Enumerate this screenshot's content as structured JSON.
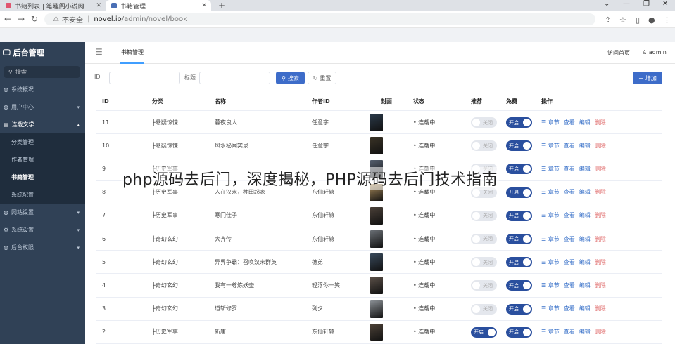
{
  "browser": {
    "tabs": [
      {
        "title": "书籍列表 | 笔趣阁小说网"
      },
      {
        "title": "书籍管理"
      }
    ],
    "url_warning": "不安全",
    "url_host": "novel.io",
    "url_path": "/admin/novel/book"
  },
  "sidebar": {
    "brand": "后台管理",
    "search_label": "搜索",
    "menu": [
      {
        "label": "系统概况"
      },
      {
        "label": "用户中心"
      },
      {
        "label": "连载文学"
      },
      {
        "label": "分类管理"
      },
      {
        "label": "作者管理"
      },
      {
        "label": "书籍管理"
      },
      {
        "label": "系统配置"
      },
      {
        "label": "网站设置"
      },
      {
        "label": "系统设置"
      },
      {
        "label": "后台权限"
      }
    ]
  },
  "topbar": {
    "tab": "书籍管理",
    "visit": "访问首页",
    "user": "admin"
  },
  "filter": {
    "id_label": "ID",
    "title_label": "标题",
    "search_btn": "搜索",
    "reset_btn": "重置",
    "add_btn": "增加"
  },
  "table": {
    "headers": [
      "ID",
      "分类",
      "名称",
      "作者ID",
      "封面",
      "状态",
      "推荐",
      "免费",
      "操作"
    ],
    "rows": [
      {
        "id": "11",
        "category": "├悬疑惊悚",
        "name": "暮夜良人",
        "author": "任意字",
        "status": "连载中",
        "recommend": "关闭",
        "free": "开启"
      },
      {
        "id": "10",
        "category": "├悬疑惊悚",
        "name": "风水秘闻实录",
        "author": "任意字",
        "status": "连载中",
        "recommend": "关闭",
        "free": "开启"
      },
      {
        "id": "9",
        "category": "├历史军事",
        "name": "",
        "author": "",
        "status": "连载中",
        "recommend": "关闭",
        "free": "开启"
      },
      {
        "id": "8",
        "category": "├历史军事",
        "name": "人在汉末，种田起家",
        "author": "东仙轩辕",
        "status": "连载中",
        "recommend": "关闭",
        "free": "开启"
      },
      {
        "id": "7",
        "category": "├历史军事",
        "name": "寒门仕子",
        "author": "东仙轩辕",
        "status": "连载中",
        "recommend": "关闭",
        "free": "开启"
      },
      {
        "id": "6",
        "category": "├奇幻玄幻",
        "name": "大齐传",
        "author": "东仙轩辕",
        "status": "连载中",
        "recommend": "关闭",
        "free": "开启"
      },
      {
        "id": "5",
        "category": "├奇幻玄幻",
        "name": "异界争霸：召唤汉末群英",
        "author": "德弟",
        "status": "连载中",
        "recommend": "关闭",
        "free": "开启"
      },
      {
        "id": "4",
        "category": "├奇幻玄幻",
        "name": "我有一尊炼妖壶",
        "author": "轻浮你一笑",
        "status": "连载中",
        "recommend": "关闭",
        "free": "开启"
      },
      {
        "id": "3",
        "category": "├奇幻玄幻",
        "name": "道斩修罗",
        "author": "列夕",
        "status": "连载中",
        "recommend": "关闭",
        "free": "开启"
      },
      {
        "id": "2",
        "category": "├历史军事",
        "name": "新唐",
        "author": "东仙轩辕",
        "status": "连载中",
        "recommend": "开启",
        "free": "开启"
      }
    ],
    "ops": [
      "章节",
      "查看",
      "编辑",
      "删除"
    ]
  },
  "overlay_text": "php源码去后门，深度揭秘，PHP源码去后门技术指南",
  "colors": {
    "sidebar": "#304156",
    "primary": "#3d6cc9",
    "toggle_on": "#2a4f9e",
    "danger": "#e06c6c"
  }
}
